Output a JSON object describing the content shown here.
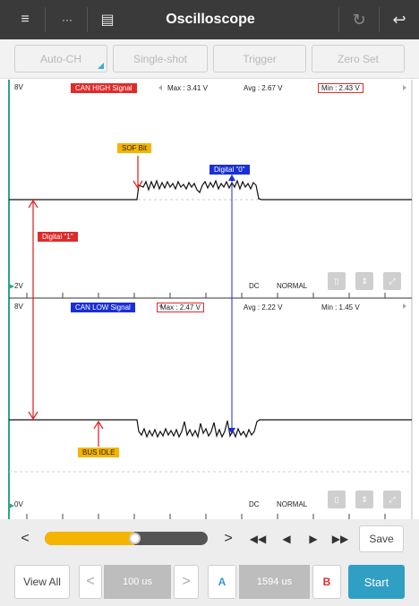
{
  "app": {
    "title": "Oscilloscope"
  },
  "toolbar": {
    "filter_icon": "≡",
    "connect_icon": "···",
    "layout_icon": "▤",
    "refresh_icon": "↻",
    "back_icon": "↩"
  },
  "modes": {
    "auto_ch": "Auto-CH",
    "single_shot": "Single-shot",
    "trigger": "Trigger",
    "zero_set": "Zero Set"
  },
  "channel1": {
    "top_label": "8V",
    "bottom_label": "2V",
    "name": "CAN HIGH Signal",
    "max": "Max : 3.41 V",
    "avg": "Avg : 2.67 V",
    "min": "Min : 2.43 V",
    "coupling": "DC",
    "mode": "NORMAL"
  },
  "channel2": {
    "top_label": "8V",
    "bottom_label": "0V",
    "name": "CAN LOW Signal",
    "max": "Max : 2.47 V",
    "avg": "Avg : 2.22 V",
    "min": "Min : 1.45 V",
    "coupling": "DC",
    "mode": "NORMAL"
  },
  "annotations": {
    "sof": "SOF Bit",
    "digital0": "Digital \"0\"",
    "digital1": "Digital \"1\"",
    "bus_idle": "BUS IDLE"
  },
  "playback": {
    "prev": "<",
    "next": ">",
    "rewind": "◀◀",
    "back": "◀",
    "forward": "▶",
    "fastforward": "▶▶",
    "save": "Save",
    "position": 0.55
  },
  "bottom": {
    "view_all": "View All",
    "timebase_prev": "<",
    "timebase": "100 us",
    "timebase_next": ">",
    "cursor_a": "A",
    "cursor_delta": "1594 us",
    "cursor_b": "B",
    "start": "Start"
  },
  "colors": {
    "accent": "#3aa9d6",
    "ch1": "#e02b2b",
    "ch2": "#1a2fd6",
    "annotation": "#f5b400",
    "start": "#2f9fc4"
  }
}
